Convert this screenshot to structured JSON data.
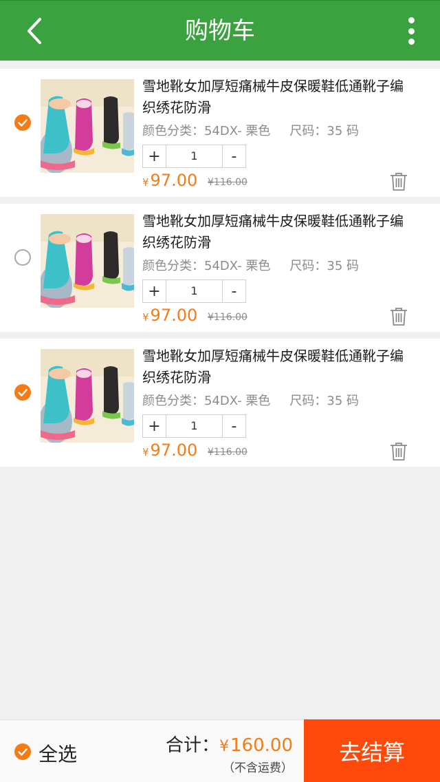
{
  "header": {
    "title": "购物车",
    "back_icon": "chevron-left-icon",
    "menu_icon": "more-vertical-icon"
  },
  "colors": {
    "brand_green": "#3aa23e",
    "accent_orange": "#f57c14",
    "checkout_red": "#ff4a0c"
  },
  "cart": {
    "items": [
      {
        "selected": true,
        "image": "product-thumbnail (snow boots)",
        "name": "雪地靴女加厚短痛械牛皮保暖鞋低通靴子编织绣花防滑",
        "color_label": "颜色分类：54DX- 栗色",
        "size_label": "尺码：35 码",
        "plus": "+",
        "quantity": "1",
        "minus": "-",
        "currency": "¥",
        "price": "97.00",
        "original_price": "¥116.00"
      },
      {
        "selected": false,
        "image": "product-thumbnail (snow boots)",
        "name": "雪地靴女加厚短痛械牛皮保暖鞋低通靴子编织绣花防滑",
        "color_label": "颜色分类：54DX- 栗色",
        "size_label": "尺码：35 码",
        "plus": "+",
        "quantity": "1",
        "minus": "-",
        "currency": "¥",
        "price": "97.00",
        "original_price": "¥116.00"
      },
      {
        "selected": true,
        "image": "product-thumbnail (snow boots)",
        "name": "雪地靴女加厚短痛械牛皮保暖鞋低通靴子编织绣花防滑",
        "color_label": "颜色分类：54DX- 栗色",
        "size_label": "尺码：35 码",
        "plus": "+",
        "quantity": "1",
        "minus": "-",
        "currency": "¥",
        "price": "97.00",
        "original_price": "¥116.00"
      }
    ]
  },
  "footer": {
    "select_all_checked": true,
    "select_all_label": "全选",
    "total_label": "合计：",
    "currency": "¥",
    "total_amount": "160.00",
    "shipping_note": "（不含运费）",
    "checkout_label": "去结算"
  }
}
